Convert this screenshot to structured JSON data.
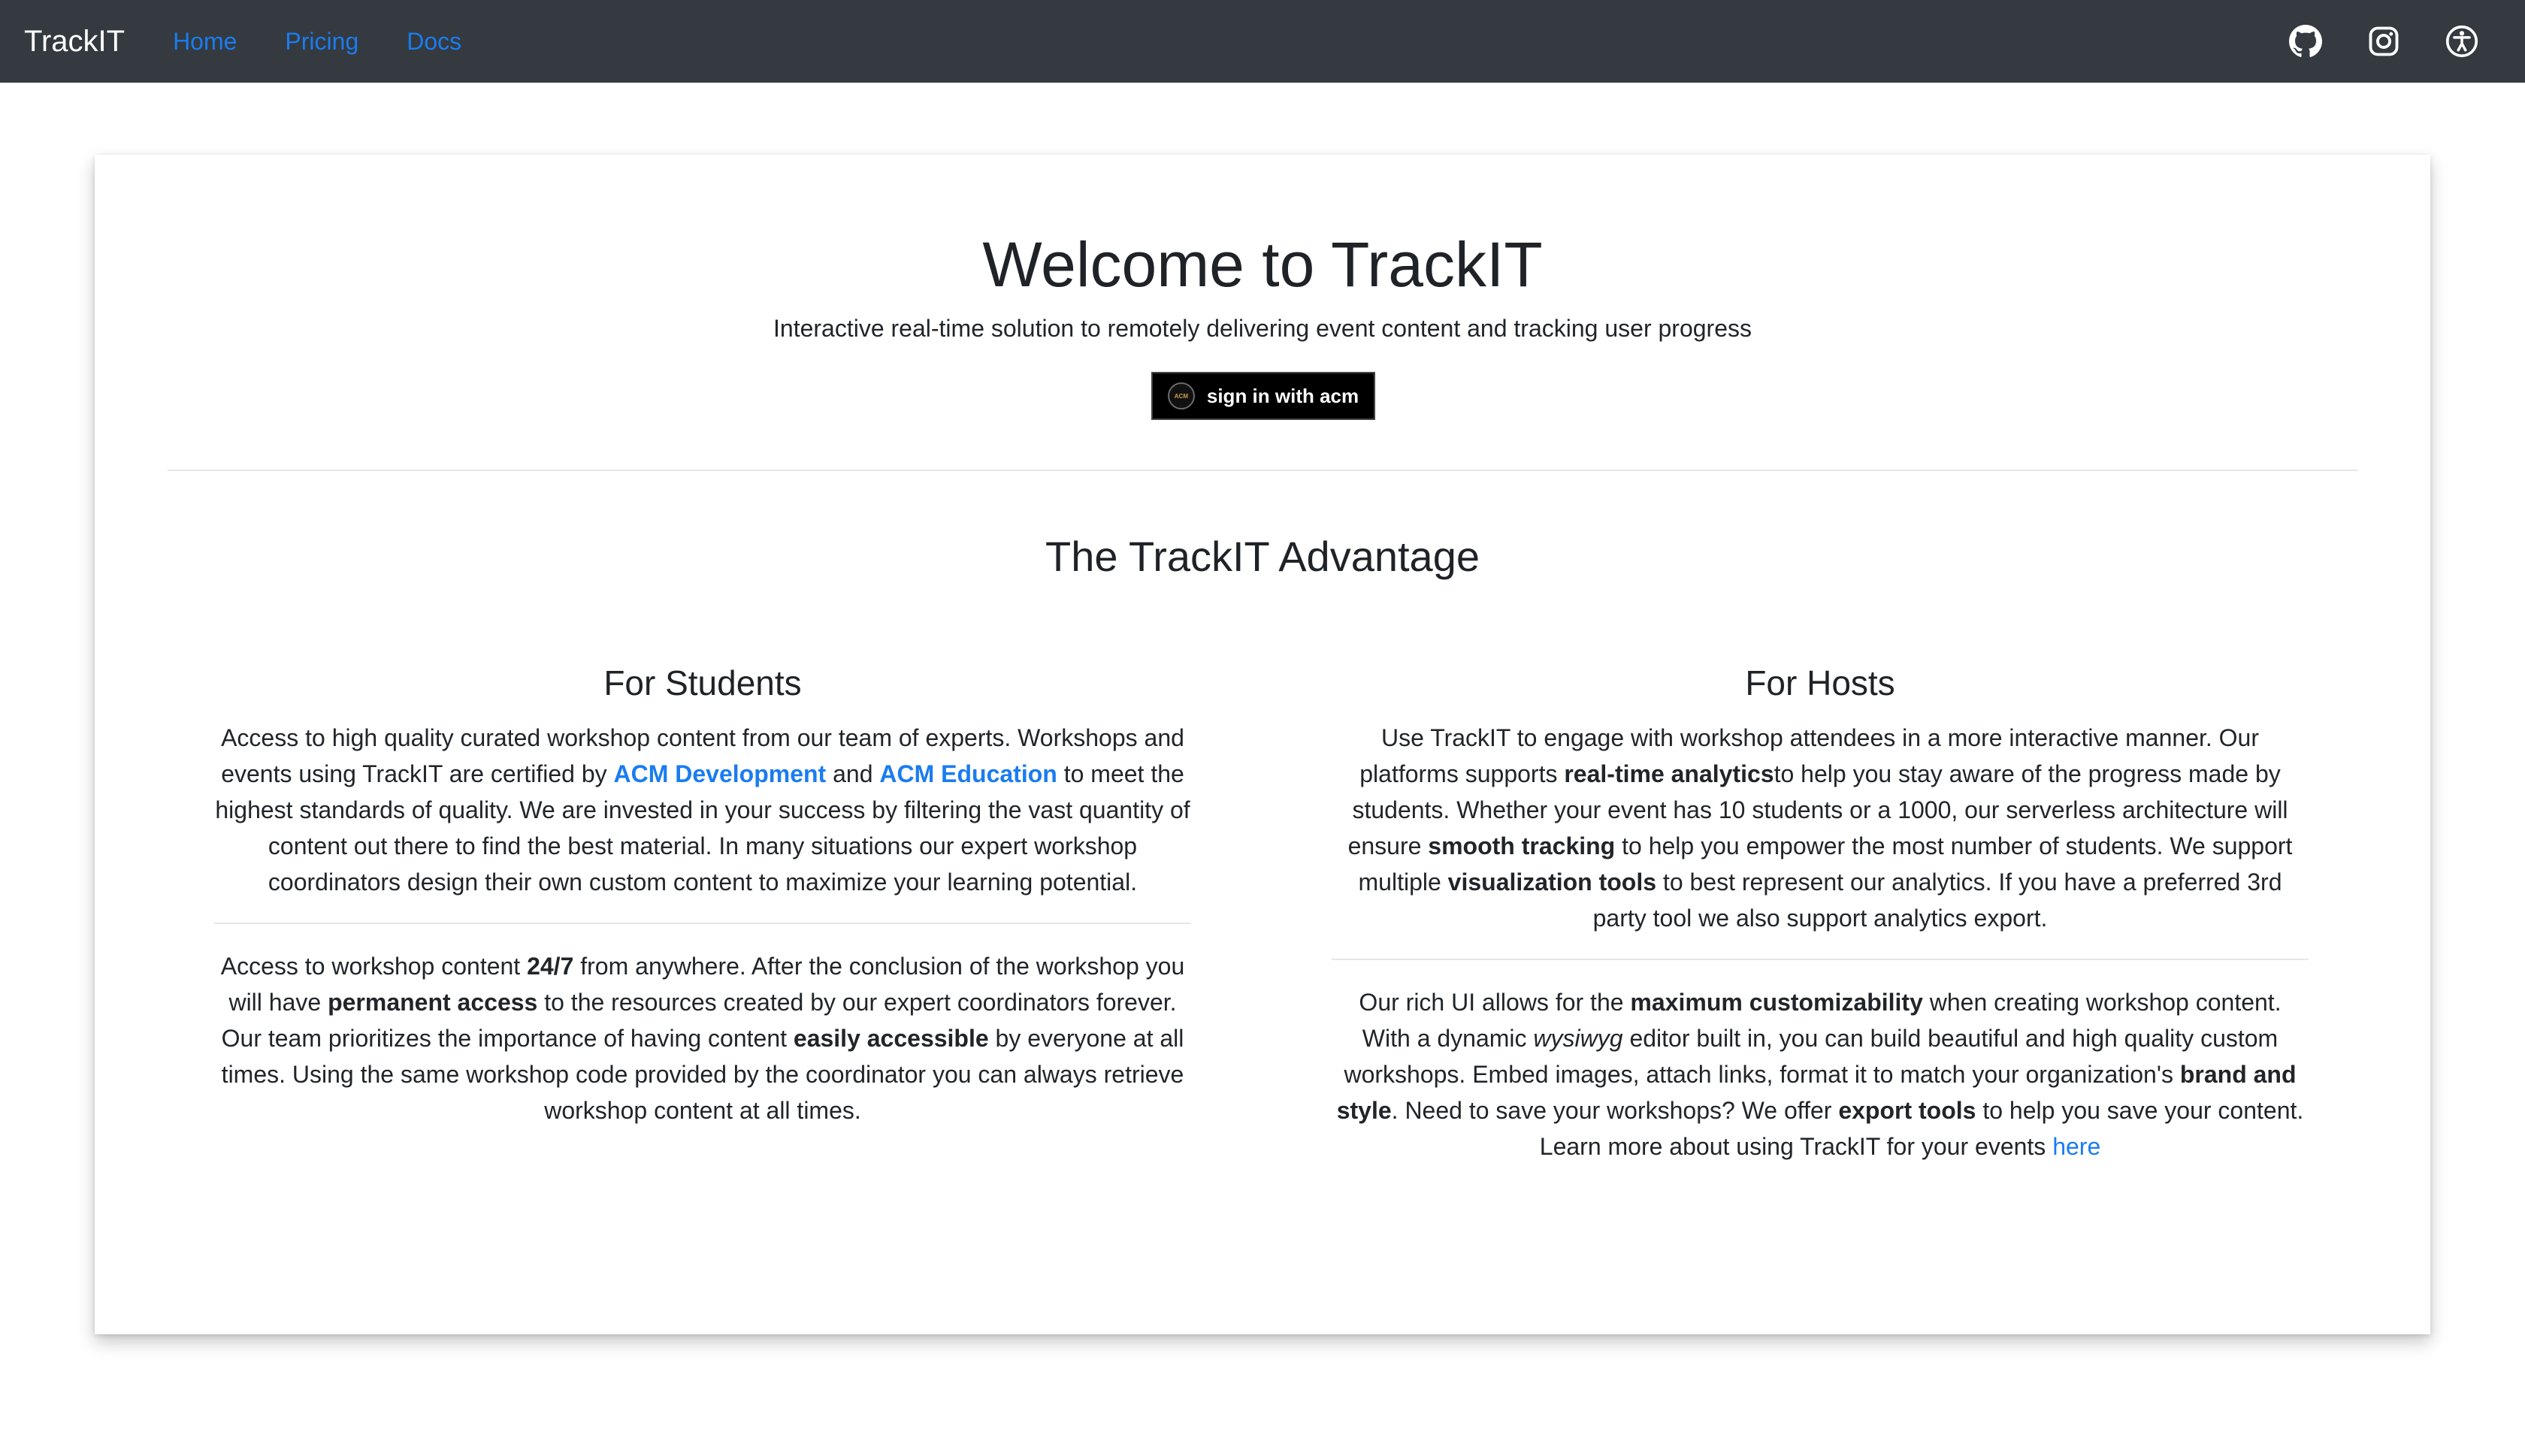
{
  "navbar": {
    "brand": "TrackIT",
    "links": [
      "Home",
      "Pricing",
      "Docs"
    ],
    "icons": [
      "github-icon",
      "instagram-icon",
      "accessibility-icon"
    ]
  },
  "hero": {
    "title": "Welcome to TrackIT",
    "subtitle": "Interactive real-time solution to remotely delivering event content and tracking user progress",
    "signin_label": "sign in with acm",
    "signin_logo_text": "ACM"
  },
  "advantage": {
    "title": "The TrackIT Advantage",
    "students": {
      "title": "For Students",
      "p1": {
        "a": "Access to high quality curated workshop content from our team of experts. Workshops and events using TrackIT are certified by ",
        "link1": "ACM Development",
        "b": " and ",
        "link2": "ACM Education",
        "c": " to meet the highest standards of quality. We are invested in your success by filtering the vast quantity of content out there to find the best material. In many situations our expert workshop coordinators design their own custom content to maximize your learning potential."
      },
      "p2": {
        "a": "Access to workshop content ",
        "b1": "24/7",
        "b": " from anywhere. After the conclusion of the workshop you will have ",
        "b2": "permanent access",
        "c": " to the resources created by our expert coordinators forever. Our team prioritizes the importance of having content ",
        "b3": "easily accessible",
        "d": " by everyone at all times. Using the same workshop code provided by the coordinator you can always retrieve workshop content at all times."
      }
    },
    "hosts": {
      "title": "For Hosts",
      "p1": {
        "a": "Use TrackIT to engage with workshop attendees in a more interactive manner. Our platforms supports ",
        "b1": "real-time analytics",
        "b": "to help you stay aware of the progress made by students. Whether your event has 10 students or a 1000, our serverless architecture will ensure ",
        "b2": "smooth tracking",
        "c": " to help you empower the most number of students. We support multiple ",
        "b3": "visualization tools",
        "d": " to best represent our analytics. If you have a preferred 3rd party tool we also support analytics export."
      },
      "p2": {
        "a": "Our rich UI allows for the ",
        "b1": "maximum customizability",
        "b": " when creating workshop content. With a dynamic ",
        "i1": "wysiwyg",
        "c": " editor built in, you can build beautiful and high quality custom workshops. Embed images, attach links, format it to match your organization's ",
        "b2": "brand and style",
        "d": ". Need to save your workshops? We offer ",
        "b3": "export tools",
        "e": " to help you save your content. Learn more about using TrackIT for your events ",
        "link": "here"
      }
    }
  },
  "colors": {
    "navbar_bg": "#343a40",
    "link": "#1a7cf0",
    "button_bg": "#000000"
  }
}
